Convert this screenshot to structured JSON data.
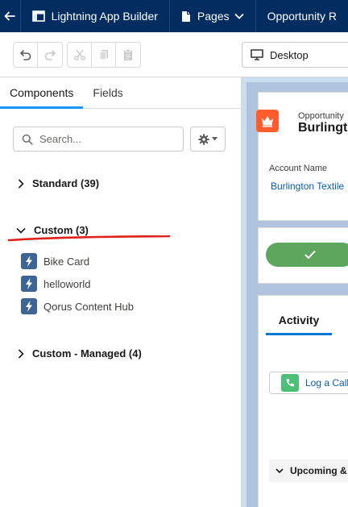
{
  "topbar": {
    "app_builder_label": "Lightning App Builder",
    "pages_label": "Pages",
    "page_name": "Opportunity R"
  },
  "toolbar": {
    "device_label": "Desktop"
  },
  "panel": {
    "tabs": [
      {
        "label": "Components",
        "active": true
      },
      {
        "label": "Fields",
        "active": false
      }
    ],
    "search_placeholder": "Search...",
    "sections": {
      "standard": "Standard (39)",
      "custom": "Custom (3)",
      "custom_managed": "Custom - Managed (4)"
    },
    "custom_components": [
      "Bike Card",
      "helloworld",
      "Qorus Content Hub"
    ]
  },
  "canvas": {
    "header_subtitle": "Opportunity",
    "header_title": "Burlingto",
    "field_label": "Account Name",
    "field_value": "Burlington Textile",
    "activity_tab": "Activity",
    "log_call": "Log a Call",
    "upcoming": "Upcoming &"
  },
  "colors": {
    "topbar_bg": "#032d60",
    "active_tab_accent": "#1b96ff",
    "component_icon_bg": "#3c6494",
    "annotation_underline": "#e0231a",
    "header_icon_bg": "#ff5d2d",
    "path_button_bg": "#5ea55e",
    "link": "#0b5cab"
  }
}
